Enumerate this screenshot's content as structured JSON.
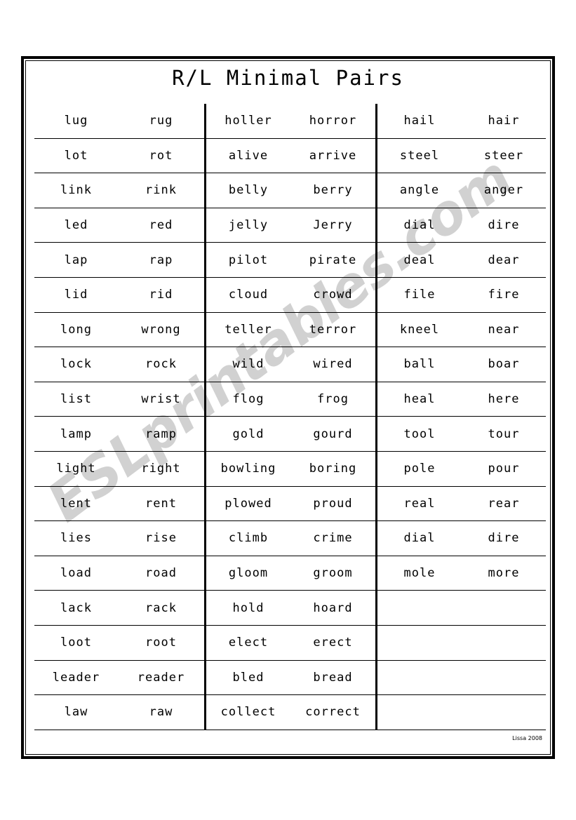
{
  "document": {
    "title": "R/L Minimal Pairs",
    "credit": "Lissa 2008",
    "watermark": "ESLprintables.com"
  },
  "table": {
    "columns": [
      {
        "name": "block-1",
        "rows": [
          [
            "lug",
            "rug"
          ],
          [
            "lot",
            "rot"
          ],
          [
            "link",
            "rink"
          ],
          [
            "led",
            "red"
          ],
          [
            "lap",
            "rap"
          ],
          [
            "lid",
            "rid"
          ],
          [
            "long",
            "wrong"
          ],
          [
            "lock",
            "rock"
          ],
          [
            "list",
            "wrist"
          ],
          [
            "lamp",
            "ramp"
          ],
          [
            "light",
            "right"
          ],
          [
            "lent",
            "rent"
          ],
          [
            "lies",
            "rise"
          ],
          [
            "load",
            "road"
          ],
          [
            "lack",
            "rack"
          ],
          [
            "loot",
            "root"
          ],
          [
            "leader",
            "reader"
          ],
          [
            "law",
            "raw"
          ]
        ]
      },
      {
        "name": "block-2",
        "rows": [
          [
            "holler",
            "horror"
          ],
          [
            "alive",
            "arrive"
          ],
          [
            "belly",
            "berry"
          ],
          [
            "jelly",
            "Jerry"
          ],
          [
            "pilot",
            "pirate"
          ],
          [
            "cloud",
            "crowd"
          ],
          [
            "teller",
            "terror"
          ],
          [
            "wild",
            "wired"
          ],
          [
            "flog",
            "frog"
          ],
          [
            "gold",
            "gourd"
          ],
          [
            "bowling",
            "boring"
          ],
          [
            "plowed",
            "proud"
          ],
          [
            "climb",
            "crime"
          ],
          [
            "gloom",
            "groom"
          ],
          [
            "hold",
            "hoard"
          ],
          [
            "elect",
            "erect"
          ],
          [
            "bled",
            "bread"
          ],
          [
            "collect",
            "correct"
          ]
        ]
      },
      {
        "name": "block-3",
        "rows": [
          [
            "hail",
            "hair"
          ],
          [
            "steel",
            "steer"
          ],
          [
            "angle",
            "anger"
          ],
          [
            "dial",
            "dire"
          ],
          [
            "deal",
            "dear"
          ],
          [
            "file",
            "fire"
          ],
          [
            "kneel",
            "near"
          ],
          [
            "ball",
            "boar"
          ],
          [
            "heal",
            "here"
          ],
          [
            "tool",
            "tour"
          ],
          [
            "pole",
            "pour"
          ],
          [
            "real",
            "rear"
          ],
          [
            "dial",
            "dire"
          ],
          [
            "mole",
            "more"
          ],
          [
            "",
            ""
          ],
          [
            "",
            ""
          ],
          [
            "",
            ""
          ],
          [
            "",
            ""
          ]
        ]
      }
    ]
  }
}
